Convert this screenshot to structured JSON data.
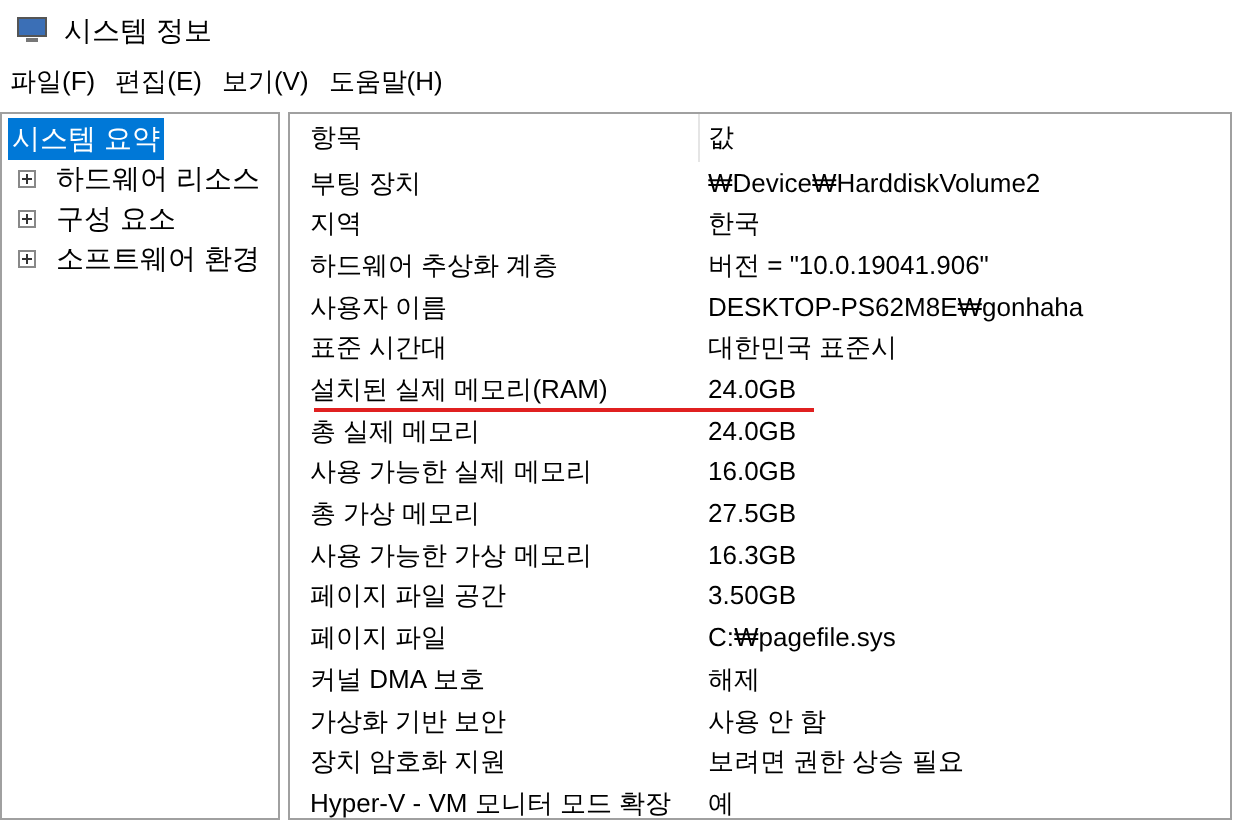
{
  "window": {
    "title": "시스템 정보"
  },
  "menu": [
    "파일(F)",
    "편집(E)",
    "보기(V)",
    "도움말(H)"
  ],
  "tree": [
    {
      "label": "시스템 요약",
      "selected": true
    },
    {
      "label": "하드웨어 리소스",
      "selected": false,
      "expanded": false
    },
    {
      "label": "구성 요소",
      "selected": false,
      "expanded": false
    },
    {
      "label": "소프트웨어 환경",
      "selected": false,
      "expanded": false
    }
  ],
  "table": {
    "columns": [
      "항목",
      "값"
    ],
    "rows": [
      {
        "item": "부팅 장치",
        "value": "₩Device₩HarddiskVolume2",
        "underlined": false
      },
      {
        "item": "지역",
        "value": "한국",
        "underlined": false
      },
      {
        "item": "하드웨어 추상화 계층",
        "value": "버전 = \"10.0.19041.906\"",
        "underlined": false
      },
      {
        "item": "사용자 이름",
        "value": "DESKTOP-PS62M8E₩gonhaha",
        "underlined": false
      },
      {
        "item": "표준 시간대",
        "value": "대한민국 표준시",
        "underlined": false
      },
      {
        "item": "설치된 실제 메모리(RAM)",
        "value": "24.0GB",
        "underlined": true
      },
      {
        "item": "총 실제 메모리",
        "value": "24.0GB",
        "underlined": false
      },
      {
        "item": "사용 가능한 실제 메모리",
        "value": "16.0GB",
        "underlined": false
      },
      {
        "item": "총 가상 메모리",
        "value": "27.5GB",
        "underlined": false
      },
      {
        "item": "사용 가능한 가상 메모리",
        "value": "16.3GB",
        "underlined": false
      },
      {
        "item": "페이지 파일 공간",
        "value": "3.50GB",
        "underlined": false
      },
      {
        "item": "페이지 파일",
        "value": "C:₩pagefile.sys",
        "underlined": false
      },
      {
        "item": "커널 DMA 보호",
        "value": "해제",
        "underlined": false
      },
      {
        "item": "가상화 기반 보안",
        "value": "사용 안 함",
        "underlined": false
      },
      {
        "item": "장치 암호화 지원",
        "value": "보려면 권한 상승 필요",
        "underlined": false
      },
      {
        "item": "Hyper-V - VM 모니터 모드 확장",
        "value": "예",
        "underlined": false
      }
    ]
  }
}
